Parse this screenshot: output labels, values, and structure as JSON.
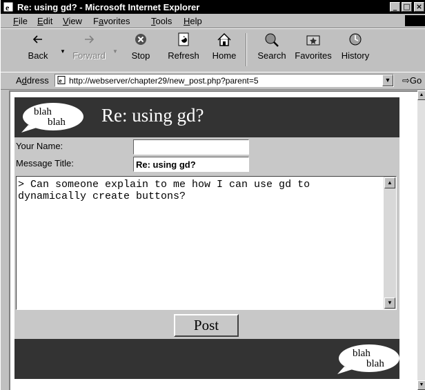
{
  "window": {
    "title": "Re: using gd? - Microsoft Internet Explorer",
    "controls": [
      "_",
      "□",
      "×"
    ]
  },
  "menu": {
    "items": [
      {
        "key": "F",
        "rest": "ile"
      },
      {
        "key": "E",
        "rest": "dit"
      },
      {
        "key": "V",
        "rest": "iew"
      },
      {
        "pre": "F",
        "key": "a",
        "rest": "vorites"
      },
      {
        "key": "T",
        "rest": "ools"
      },
      {
        "key": "H",
        "rest": "elp"
      }
    ]
  },
  "toolbar": {
    "back": "Back",
    "forward": "Forward",
    "stop": "Stop",
    "refresh": "Refresh",
    "home": "Home",
    "search": "Search",
    "favorites": "Favorites",
    "history": "History"
  },
  "address": {
    "label_pre": "A",
    "label_key": "d",
    "label_rest": "dress",
    "url": "http://webserver/chapter29/new_post.php?parent=5",
    "go": "Go"
  },
  "page": {
    "logo_line1": "blah",
    "logo_line2": "blah",
    "heading": "Re: using gd?",
    "name_label": "Your Name:",
    "name_value": "",
    "title_label": "Message Title:",
    "title_value": "Re: using gd?",
    "message": "> Can someone explain to me how I can use gd to\ndynamically create buttons?",
    "post_button": "Post"
  },
  "colors": {
    "banner": "#333333",
    "form_bg": "#c8c8c8",
    "chrome": "#c0c0c0"
  }
}
